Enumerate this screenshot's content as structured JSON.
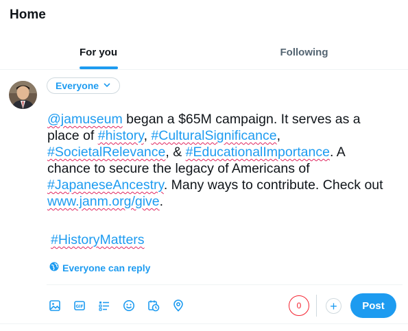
{
  "header": {
    "title": "Home"
  },
  "tabs": [
    {
      "label": "For you",
      "active": true
    },
    {
      "label": "Following",
      "active": false
    }
  ],
  "composer": {
    "audience_label": "Everyone",
    "text": {
      "mention": "@jamuseum",
      "t1": " began a $65M campaign. It serves as a place of ",
      "tag1": "#history",
      "t2": ", ",
      "tag2": "#CulturalSignificance",
      "t3": ", ",
      "tag3": "#SocietalRelevance",
      "t4": ", & ",
      "tag4": "#EducationalImportance",
      "t5": ". A chance to secure the legacy of Americans of ",
      "tag5": "#JapaneseAncestry",
      "t6": ".  Many ways to contribute. Check out ",
      "url": "www.janm.org/give",
      "t7": ".",
      "tag6": "#HistoryMatters"
    },
    "reply_setting": "Everyone can reply",
    "char_counter": "0",
    "post_label": "Post"
  },
  "toolbar_icons": [
    "image-icon",
    "gif-icon",
    "poll-icon",
    "emoji-icon",
    "schedule-icon",
    "location-icon"
  ],
  "colors": {
    "accent": "#1d9bf0",
    "warning": "#f4212e",
    "text": "#0f1419",
    "muted": "#536471"
  }
}
